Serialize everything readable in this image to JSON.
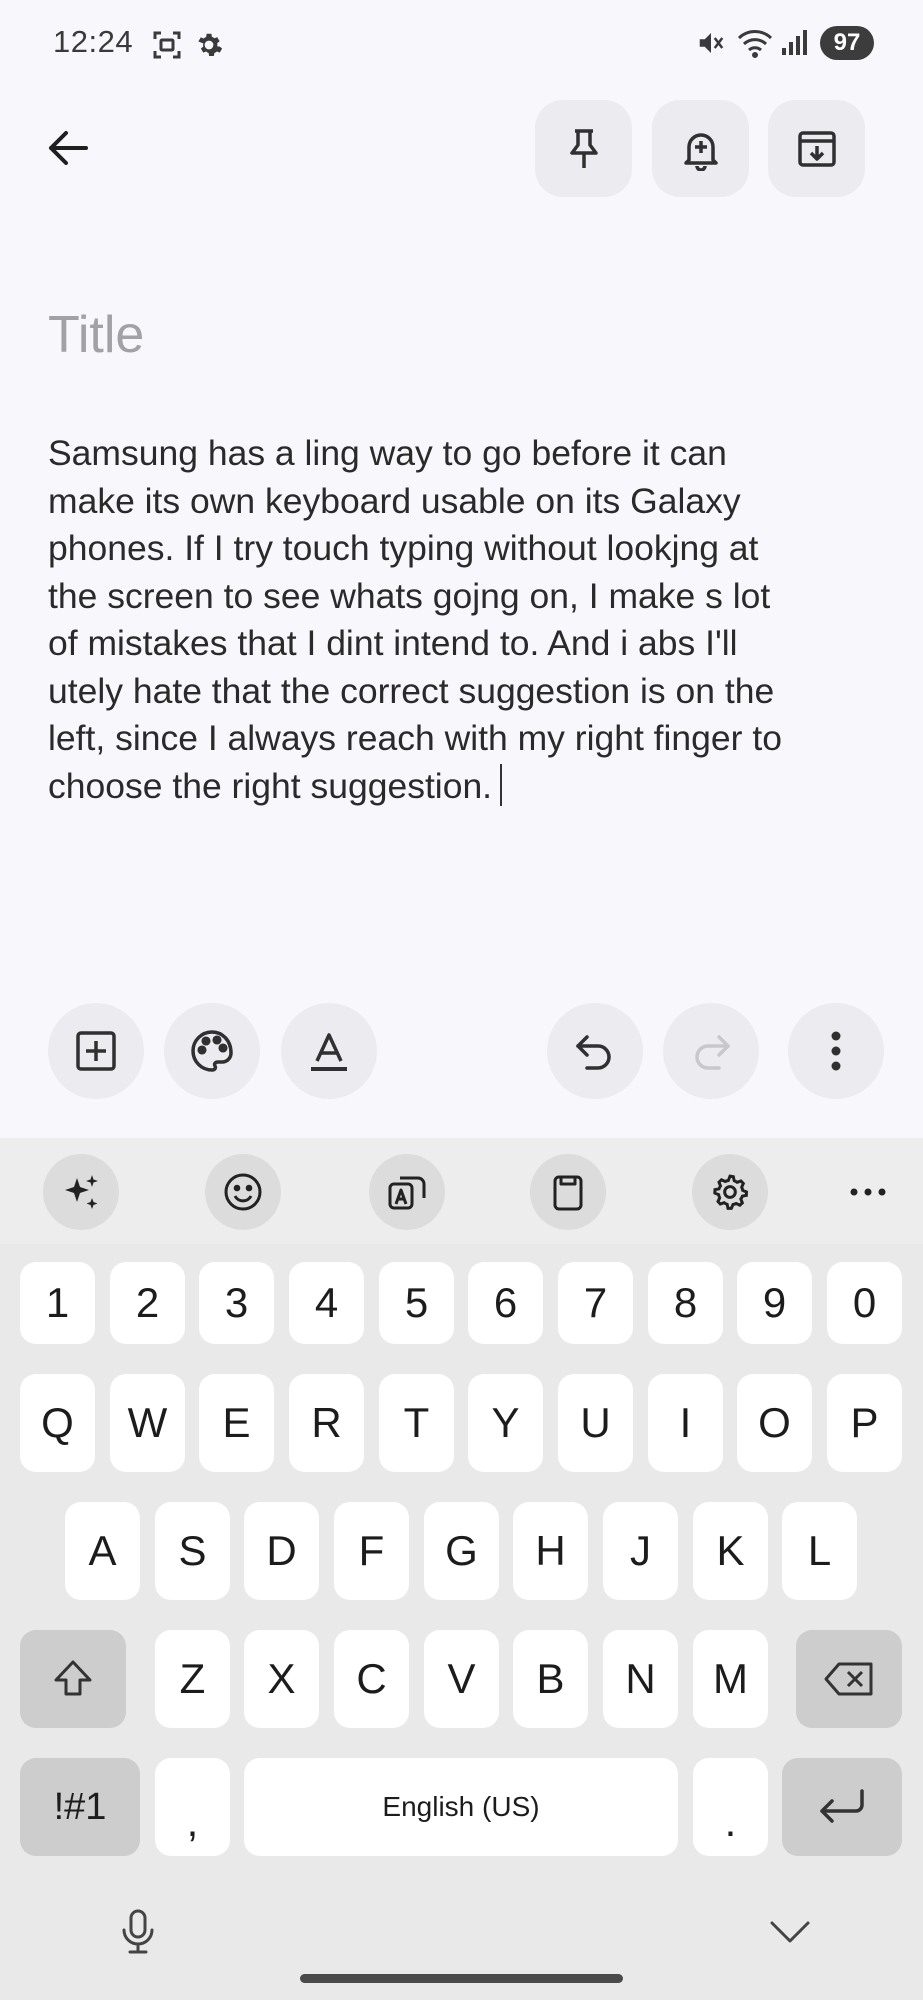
{
  "status_bar": {
    "time": "12:24",
    "battery": "97",
    "icons": [
      "screen-recorder-icon",
      "settings-gear-icon",
      "mute-icon",
      "wifi-icon",
      "signal-icon"
    ]
  },
  "top_bar": {
    "back_icon": "arrow-left-icon",
    "actions": [
      "pin-icon",
      "reminder-bell-icon",
      "archive-icon"
    ]
  },
  "note": {
    "title_placeholder": "Title",
    "title_value": "",
    "body_lines": [
      "Samsung has a ling way to go before it can",
      "make its own keyboard usable on its Galaxy",
      "phones. If I try touch typing without lookjng at",
      "the screen to see whats gojng on, I make s lot",
      "of mistakes that I dint intend to. And i abs I'll",
      "utely hate that the correct suggestion is on the",
      "left, since I always reach with my right finger to",
      "choose the right suggestion."
    ]
  },
  "note_toolbar": {
    "left": [
      "add-box-icon",
      "palette-icon",
      "text-format-icon"
    ],
    "right": [
      "undo-icon",
      "redo-icon",
      "more-vert-icon"
    ]
  },
  "keyboard": {
    "toolbar": [
      "ai-sparkle-icon",
      "emoji-icon",
      "translate-icon",
      "clipboard-icon",
      "settings-icon",
      "more-horiz-icon"
    ],
    "row_numbers": [
      "1",
      "2",
      "3",
      "4",
      "5",
      "6",
      "7",
      "8",
      "9",
      "0"
    ],
    "row_1": [
      "Q",
      "W",
      "E",
      "R",
      "T",
      "Y",
      "U",
      "I",
      "O",
      "P"
    ],
    "row_2": [
      "A",
      "S",
      "D",
      "F",
      "G",
      "H",
      "J",
      "K",
      "L"
    ],
    "row_3": [
      "Z",
      "X",
      "C",
      "V",
      "B",
      "N",
      "M"
    ],
    "symbols_label": "!#1",
    "comma_label": ",",
    "space_label": "English (US)",
    "period_label": ".",
    "bottom_icons": [
      "microphone-icon",
      "keyboard-hide-chevron-icon"
    ]
  }
}
